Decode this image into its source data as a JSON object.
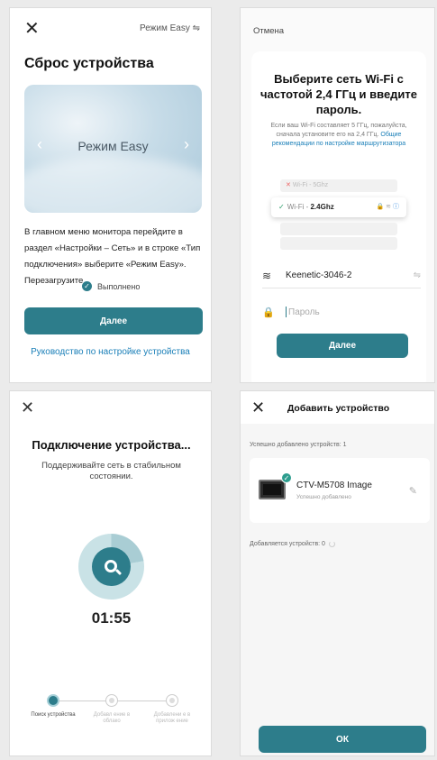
{
  "screens": {
    "reset": {
      "close_glyph": "✕",
      "mode_toggle": "Режим Easy ⇋",
      "title": "Сброс устройства",
      "banner_text": "Режим Easy",
      "instruction": "В главном меню монитора перейдите в раздел «Настройки – Сеть» и в строке «Тип подключения» выберите «Режим Easy». Перезагрузите",
      "done_label": "Выполнено",
      "next_button": "Далее",
      "guide_link": "Руководство по настройке устройства"
    },
    "wifi": {
      "cancel": "Отмена",
      "title": "Выберите сеть Wi-Fi с частотой 2,4 ГГц и введите пароль.",
      "hint": "Если ваш Wi-Fi составляет 5 ГГц, пожалуйста, сначала установите его на 2,4 ГГц.",
      "hint_link": "Общие рекомендации по настройке маршрутизатора",
      "illus_5g": "Wi-Fi - 5Ghz",
      "illus_24_prefix": "Wi-Fi - ",
      "illus_24_band": "2.4Ghz",
      "ssid": "Keenetic-3046-2",
      "password_placeholder": "Пароль",
      "next_button": "Далее"
    },
    "connecting": {
      "close_glyph": "✕",
      "title": "Подключение устройства...",
      "subtitle": "Поддерживайте сеть в стабильном состоянии.",
      "timer": "01:55",
      "steps": [
        {
          "label": "Поиск устройства",
          "state": "active"
        },
        {
          "label": "Добавл ение в облако",
          "state": "pending"
        },
        {
          "label": "Добавлени е в прилож ение",
          "state": "pending"
        }
      ]
    },
    "added": {
      "close_glyph": "✕",
      "title": "Добавить устройство",
      "added_count": "Успешно добавлено устройств: 1",
      "device_name": "CTV-M5708 Image",
      "device_status": "Успешно добавлено",
      "adding_count": "Добавляется устройств: 0",
      "ok_button": "ОК"
    }
  },
  "colors": {
    "accent": "#2d7d8b",
    "link": "#1a7fb8",
    "success": "#2d9d8e"
  }
}
